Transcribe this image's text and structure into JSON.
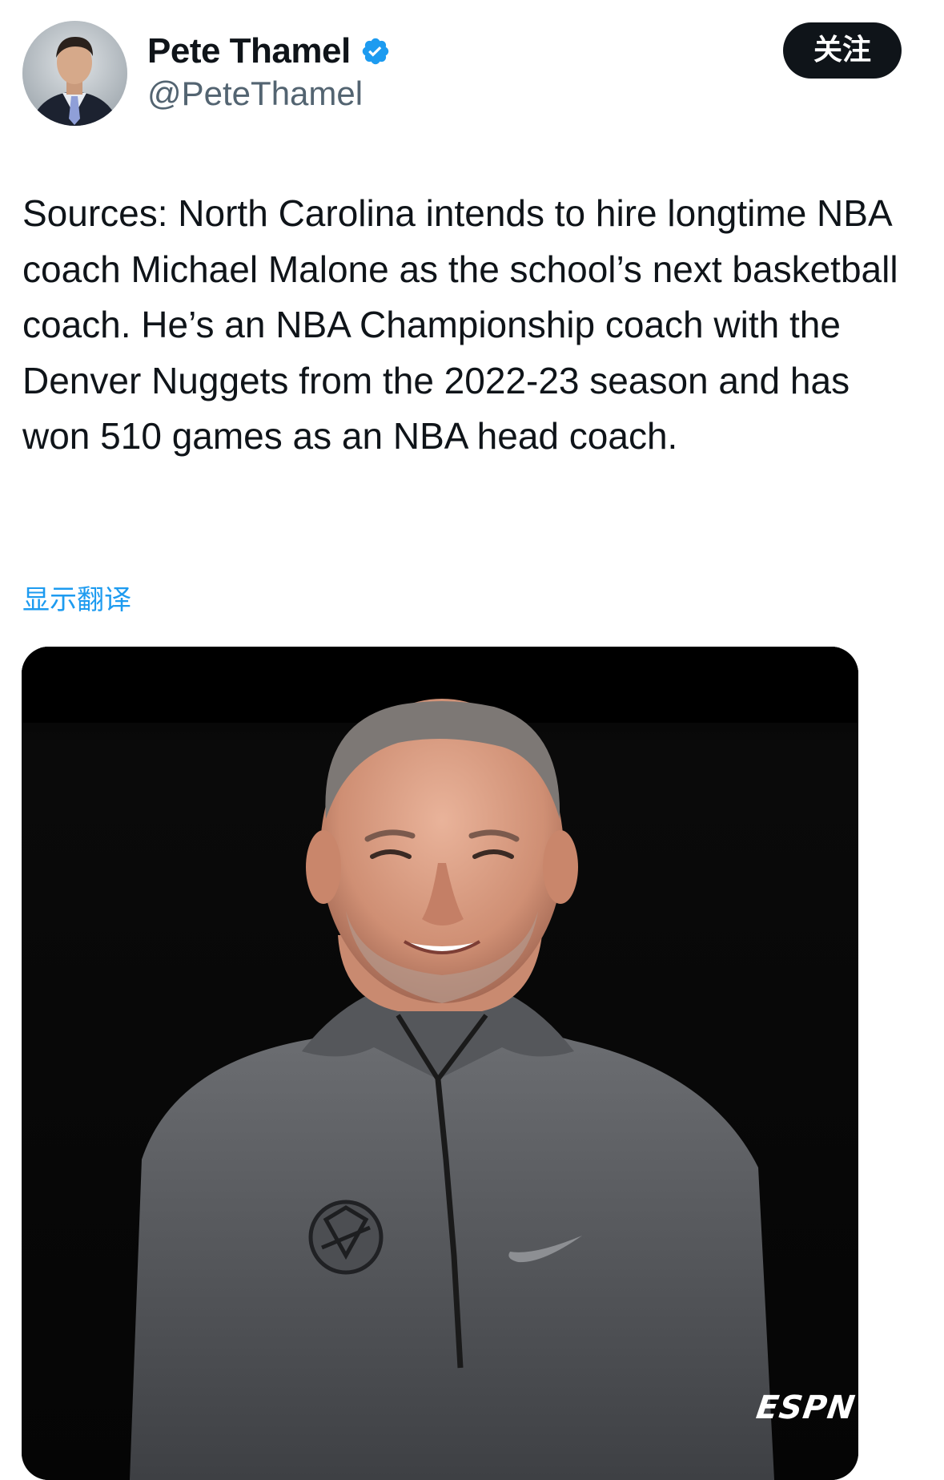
{
  "author": {
    "display_name": "Pete Thamel",
    "handle": "@PeteThamel",
    "verified": true
  },
  "actions": {
    "follow_label": "关注",
    "translate_label": "显示翻译"
  },
  "tweet": {
    "text": "Sources: North Carolina intends to hire longtime NBA coach Michael Malone as the school’s next basketball coach. He’s an NBA Championship coach with the Denver Nuggets from the 2022-23 season and has won 510 games as an NBA head coach."
  },
  "media": {
    "watermark": "ESPN"
  },
  "colors": {
    "text_primary": "#0f1419",
    "text_secondary": "#536471",
    "link": "#1d9bf0",
    "verified": "#1d9bf0",
    "button_bg": "#0f1419"
  },
  "icons": {
    "verified": "verified-badge-icon",
    "team_logo": "nuggets-logo-icon",
    "brand": "swoosh-logo-icon"
  }
}
